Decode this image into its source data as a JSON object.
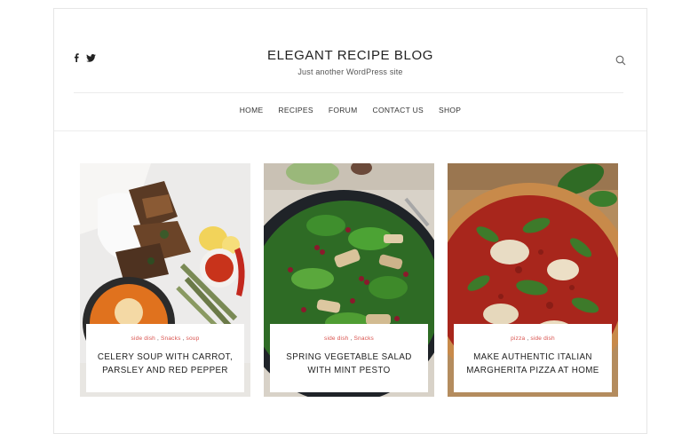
{
  "header": {
    "title": "ELEGANT RECIPE BLOG",
    "tagline": "Just another WordPress site",
    "social": [
      {
        "icon": "facebook-icon",
        "glyph": "f"
      },
      {
        "icon": "twitter-icon",
        "glyph": "🐦"
      }
    ],
    "search_icon": "search-icon"
  },
  "nav": {
    "items": [
      "HOME",
      "RECIPES",
      "FORUM",
      "CONTACT US",
      "SHOP"
    ]
  },
  "posts": [
    {
      "categories": [
        "side dish",
        "Snacks",
        "soup"
      ],
      "title": "CELERY SOUP WITH CARROT, PARSLEY AND RED PEPPER"
    },
    {
      "categories": [
        "side dish",
        "Snacks"
      ],
      "title": "SPRING VEGETABLE SALAD WITH MINT PESTO"
    },
    {
      "categories": [
        "pizza",
        "side dish"
      ],
      "title": "MAKE AUTHENTIC ITALIAN MARGHERITA PIZZA AT HOME"
    }
  ],
  "colors": {
    "category": "#d9534f",
    "text": "#222222",
    "border": "#e6e6e6"
  }
}
